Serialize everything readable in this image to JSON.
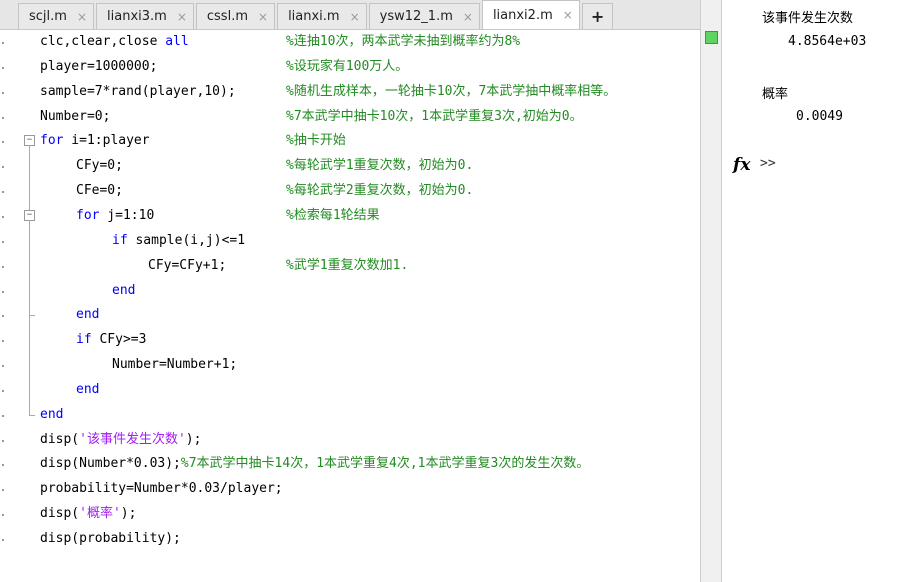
{
  "tabs": [
    {
      "label": "scjl.m",
      "active": false
    },
    {
      "label": "lianxi3.m",
      "active": false
    },
    {
      "label": "cssl.m",
      "active": false
    },
    {
      "label": "lianxi.m",
      "active": false
    },
    {
      "label": "ysw12_1.m",
      "active": false
    },
    {
      "label": "lianxi2.m",
      "active": true
    }
  ],
  "add_tab_label": "+",
  "close_glyph": "×",
  "code_lines": [
    {
      "indent": 0,
      "parts": [
        [
          "p",
          "clc,clear,close "
        ],
        [
          "kw",
          "all"
        ]
      ],
      "comment": "%连抽10次，两本武学未抽到概率约为8%"
    },
    {
      "indent": 0,
      "parts": [
        [
          "p",
          "player=1000000;"
        ]
      ],
      "comment": "%设玩家有100万人。"
    },
    {
      "indent": 0,
      "parts": [
        [
          "p",
          "sample=7*rand(player,10);"
        ]
      ],
      "comment": "%随机生成样本，一轮抽卡10次，7本武学抽中概率相等。"
    },
    {
      "indent": 0,
      "parts": [
        [
          "p",
          "Number=0;"
        ]
      ],
      "comment": "%7本武学中抽卡10次，1本武学重复3次,初始为0。"
    },
    {
      "indent": 0,
      "parts": [
        [
          "kw",
          "for"
        ],
        [
          "p",
          " i=1:player"
        ]
      ],
      "comment": "%抽卡开始"
    },
    {
      "indent": 1,
      "parts": [
        [
          "p",
          "CFy=0;"
        ]
      ],
      "comment": "%每轮武学1重复次数，初始为0."
    },
    {
      "indent": 1,
      "parts": [
        [
          "p",
          "CFe=0;"
        ]
      ],
      "comment": "%每轮武学2重复次数，初始为0."
    },
    {
      "indent": 1,
      "parts": [
        [
          "kw",
          "for"
        ],
        [
          "p",
          " j=1:10"
        ]
      ],
      "comment": "%检索每1轮结果"
    },
    {
      "indent": 2,
      "parts": [
        [
          "kw",
          "if"
        ],
        [
          "p",
          " sample(i,j)<=1"
        ]
      ],
      "comment": ""
    },
    {
      "indent": 3,
      "parts": [
        [
          "p",
          "CFy=CFy+1;"
        ]
      ],
      "comment": "%武学1重复次数加1."
    },
    {
      "indent": 2,
      "parts": [
        [
          "kw",
          "end"
        ]
      ],
      "comment": ""
    },
    {
      "indent": 1,
      "parts": [
        [
          "kw",
          "end"
        ]
      ],
      "comment": ""
    },
    {
      "indent": 1,
      "parts": [
        [
          "kw",
          "if"
        ],
        [
          "p",
          " CFy>=3"
        ]
      ],
      "comment": ""
    },
    {
      "indent": 2,
      "parts": [
        [
          "p",
          "Number=Number+1;"
        ]
      ],
      "comment": ""
    },
    {
      "indent": 1,
      "parts": [
        [
          "kw",
          "end"
        ]
      ],
      "comment": ""
    },
    {
      "indent": 0,
      "parts": [
        [
          "kw",
          "end"
        ]
      ],
      "comment": ""
    },
    {
      "indent": 0,
      "parts": [
        [
          "p",
          "disp("
        ],
        [
          "str",
          "'该事件发生次数'"
        ],
        [
          "p",
          ");"
        ]
      ],
      "comment": ""
    },
    {
      "indent": 0,
      "parts": [
        [
          "p",
          "disp(Number*0.03);"
        ],
        [
          "cm",
          "%7本武学中抽卡14次，1本武学重复4次,1本武学重复3次的发生次数。"
        ]
      ],
      "comment": ""
    },
    {
      "indent": 0,
      "parts": [
        [
          "p",
          "probability=Number*0.03/player;"
        ]
      ],
      "comment": ""
    },
    {
      "indent": 0,
      "parts": [
        [
          "p",
          "disp("
        ],
        [
          "str",
          "'概率'"
        ],
        [
          "p",
          ");"
        ]
      ],
      "comment": ""
    },
    {
      "indent": 0,
      "parts": [
        [
          "p",
          "disp(probability);"
        ]
      ],
      "comment": ""
    }
  ],
  "command_window": {
    "label1": "该事件发生次数",
    "value1": "4.8564e+03",
    "label2": "概率",
    "value2": "0.0049",
    "fx": "fx",
    "prompt": ">>"
  },
  "colors": {
    "keyword": "#0000ff",
    "string": "#a020f0",
    "comment": "#228b22"
  }
}
